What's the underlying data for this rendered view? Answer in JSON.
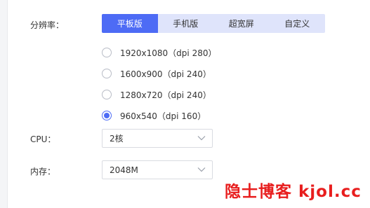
{
  "resolution": {
    "label": "分辨率：",
    "tabs": [
      {
        "label": "平板版",
        "active": true
      },
      {
        "label": "手机版",
        "active": false
      },
      {
        "label": "超宽屏",
        "active": false
      },
      {
        "label": "自定义",
        "active": false
      }
    ],
    "options": [
      {
        "label": "1920x1080（dpi 280）",
        "checked": false
      },
      {
        "label": "1600x900（dpi 240）",
        "checked": false
      },
      {
        "label": "1280x720（dpi 240）",
        "checked": false
      },
      {
        "label": "960x540（dpi 160）",
        "checked": true
      }
    ]
  },
  "cpu": {
    "label": "CPU：",
    "value": "2核"
  },
  "memory": {
    "label": "内存：",
    "value": "2048M"
  },
  "watermark": "隐士博客 kjol.cc",
  "colors": {
    "accent": "#4d6bf5",
    "tab_bg": "#dfe4fb",
    "watermark": "#e81e1e"
  }
}
